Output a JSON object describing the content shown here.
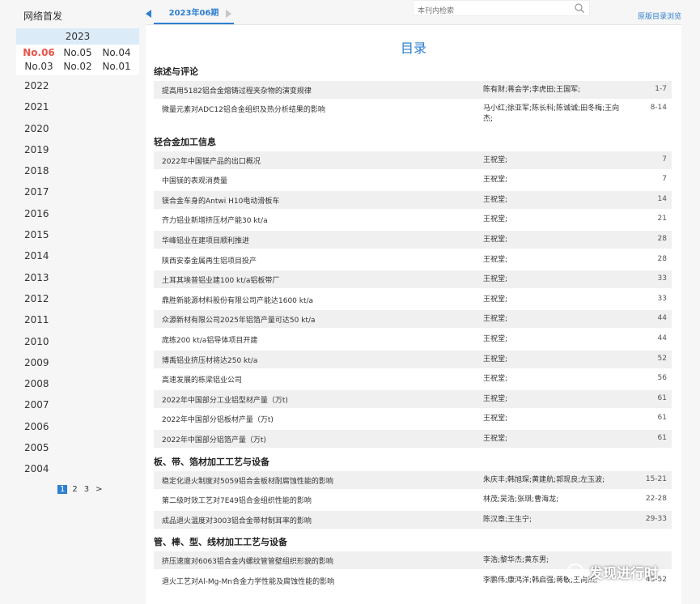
{
  "sidebar": {
    "net_first": "网络首发",
    "current_year": "2023",
    "issues": [
      "No.06",
      "No.05",
      "No.04",
      "No.03",
      "No.02",
      "No.01"
    ],
    "active_issue": "No.06",
    "years": [
      "2022",
      "2021",
      "2020",
      "2019",
      "2018",
      "2017",
      "2016",
      "2015",
      "2014",
      "2013",
      "2012",
      "2011",
      "2010",
      "2009",
      "2008",
      "2007",
      "2006",
      "2005",
      "2004"
    ],
    "pages": [
      "1",
      "2",
      "3",
      ">"
    ]
  },
  "topbar": {
    "issue_tab": "2023年06期",
    "search_placeholder": "本刊内检索",
    "original_link": "原版目录浏览"
  },
  "toc": {
    "title": "目录",
    "sections": [
      {
        "name": "综述与评论",
        "items": [
          {
            "title": "提高用5182铝合金熔铸过程夹杂物的演变规律",
            "authors": "陈有财;蒋会学;李虎田;王国军;",
            "pages": "1-7"
          },
          {
            "title": "微量元素对ADC12铝合金组织及热分析结果的影响",
            "authors": "马小红;徐亚军;陈长科;陈诚诚;田冬梅;王向杰;",
            "pages": "8-14"
          }
        ]
      },
      {
        "name": "轻合金加工信息",
        "items": [
          {
            "title": "2022年中国镁产品的出口概况",
            "authors": "王祝堂;",
            "pages": "7"
          },
          {
            "title": "中国镁的表观消费量",
            "authors": "王祝堂;",
            "pages": "7"
          },
          {
            "title": "镁合金车身的Antwi H10电动滑板车",
            "authors": "王祝堂;",
            "pages": "14"
          },
          {
            "title": "齐力铝业新增挤压材产能30 kt/a",
            "authors": "王祝堂;",
            "pages": "21"
          },
          {
            "title": "华峰铝业在建项目顺利推进",
            "authors": "王祝堂;",
            "pages": "28"
          },
          {
            "title": "陕西安泰金属再生铝项目投产",
            "authors": "王祝堂;",
            "pages": "28"
          },
          {
            "title": "土耳其埃普铝业建100 kt/a铝板带厂",
            "authors": "王祝堂;",
            "pages": "33"
          },
          {
            "title": "鼎胜新能源材料股份有限公司产能达1600 kt/a",
            "authors": "王祝堂;",
            "pages": "33"
          },
          {
            "title": "众源新材有限公司2025年铝箔产量可达50 kt/a",
            "authors": "王祝堂;",
            "pages": "44"
          },
          {
            "title": "庞练200 kt/a铝导体项目开建",
            "authors": "王祝堂;",
            "pages": "44"
          },
          {
            "title": "博禹铝业挤压材将达250 kt/a",
            "authors": "王祝堂;",
            "pages": "52"
          },
          {
            "title": "高速发展的栋梁铝业公司",
            "authors": "王祝堂;",
            "pages": "56"
          },
          {
            "title": "2022年中国部分工业铝型材产量（万t)",
            "authors": "王祝堂;",
            "pages": "61"
          },
          {
            "title": "2022年中国部分铝板材产量（万t)",
            "authors": "王祝堂;",
            "pages": "61"
          },
          {
            "title": "2022年中国部分铝箔产量（万t)",
            "authors": "王祝堂;",
            "pages": "61"
          }
        ]
      },
      {
        "name": "板、带、箔材加工工艺与设备",
        "items": [
          {
            "title": "稳定化退火制度对5059铝合金板材耐腐蚀性能的影响",
            "authors": "朱庆丰;韩旭琛;黄建航;郭现良;左玉波;",
            "pages": "15-21"
          },
          {
            "title": "第二级时效工艺对7E49铝合金组织性能的影响",
            "authors": "林茂;吴浩;张琪;曹海龙;",
            "pages": "22-28"
          },
          {
            "title": "成品退火温度对3003铝合金带材制耳率的影响",
            "authors": "陈汉章;王生宁;",
            "pages": "29-33"
          }
        ]
      },
      {
        "name": "管、棒、型、线材加工工艺与设备",
        "items": [
          {
            "title": "挤压速度对6063铝合金内螺纹管管壁组织形貌的影响",
            "authors": "李浩;黎华杰;黄东男;",
            "pages": ""
          },
          {
            "title": "退火工艺对Al-Mg-Mn合金力学性能及腐蚀性能的影响",
            "authors": "李鹏伟;康鸿洋;韩启强;蒋敏;王向杰;",
            "pages": "45-52"
          }
        ]
      }
    ]
  },
  "watermark": "发现进行时",
  "colors": {
    "accent": "#2f7fd1",
    "active_issue": "#e8534a",
    "year_head": "#dcebf8",
    "row_shade": "#f0f0f0"
  }
}
